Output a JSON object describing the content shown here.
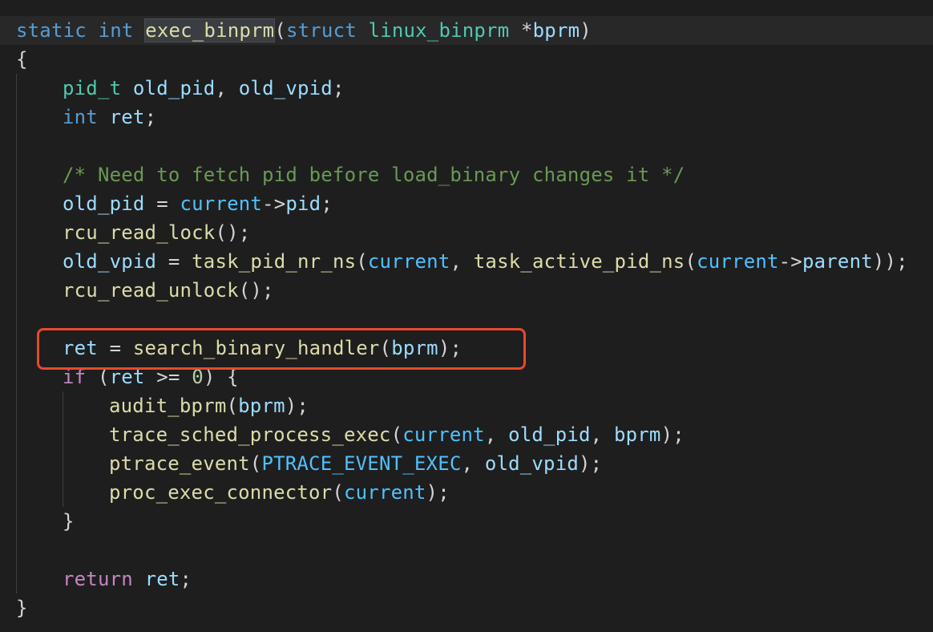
{
  "colors": {
    "background": "#1e1e1e",
    "keyword": "#569cd6",
    "control_keyword": "#c586c0",
    "type": "#4ec9b0",
    "function": "#dcdcaa",
    "variable": "#9cdcfe",
    "macro": "#4fc1ff",
    "comment": "#6a9955",
    "text": "#d4d4d4",
    "annotation": "#e8492c"
  },
  "code": {
    "l1": {
      "static": "static",
      "int": "int",
      "fname": "exec_binprm",
      "paren_open": "(",
      "struct": "struct",
      "stype": "linux_binprm",
      "star": "*",
      "param": "bprm",
      "paren_close": ")"
    },
    "l2": {
      "brace": "{"
    },
    "l3": {
      "type": "pid_t",
      "v1": "old_pid",
      "comma": ", ",
      "v2": "old_vpid",
      "semi": ";"
    },
    "l4": {
      "int": "int",
      "v": "ret",
      "semi": ";"
    },
    "l6": {
      "comment": "/* Need to fetch pid before load_binary changes it */"
    },
    "l7": {
      "v": "old_pid",
      "eq": " = ",
      "cur": "current",
      "arrow": "->",
      "field": "pid",
      "semi": ";"
    },
    "l8": {
      "fn": "rcu_read_lock",
      "rest": "();"
    },
    "l9": {
      "v": "old_vpid",
      "eq": " = ",
      "fn": "task_pid_nr_ns",
      "p1": "(",
      "cur1": "current",
      "comma": ", ",
      "fn2": "task_active_pid_ns",
      "p2": "(",
      "cur2": "current",
      "arrow": "->",
      "field": "parent",
      "end": "));"
    },
    "l10": {
      "fn": "rcu_read_unlock",
      "rest": "();"
    },
    "l12": {
      "v": "ret",
      "eq": " = ",
      "fn": "search_binary_handler",
      "p": "(",
      "arg": "bprm",
      "end": ");"
    },
    "l13": {
      "kw": "if",
      "p": " (",
      "v": "ret",
      "op": " >= ",
      "num": "0",
      "end": ") {"
    },
    "l14": {
      "fn": "audit_bprm",
      "p": "(",
      "arg": "bprm",
      "end": ");"
    },
    "l15": {
      "fn": "trace_sched_process_exec",
      "p": "(",
      "cur": "current",
      "c1": ", ",
      "a2": "old_pid",
      "c2": ", ",
      "a3": "bprm",
      "end": ");"
    },
    "l16": {
      "fn": "ptrace_event",
      "p": "(",
      "macro": "PTRACE_EVENT_EXEC",
      "c": ", ",
      "arg": "old_vpid",
      "end": ");"
    },
    "l17": {
      "fn": "proc_exec_connector",
      "p": "(",
      "cur": "current",
      "end": ");"
    },
    "l18": {
      "brace": "}"
    },
    "l20": {
      "kw": "return",
      "sp": " ",
      "v": "ret",
      "semi": ";"
    },
    "l21": {
      "brace": "}"
    }
  }
}
